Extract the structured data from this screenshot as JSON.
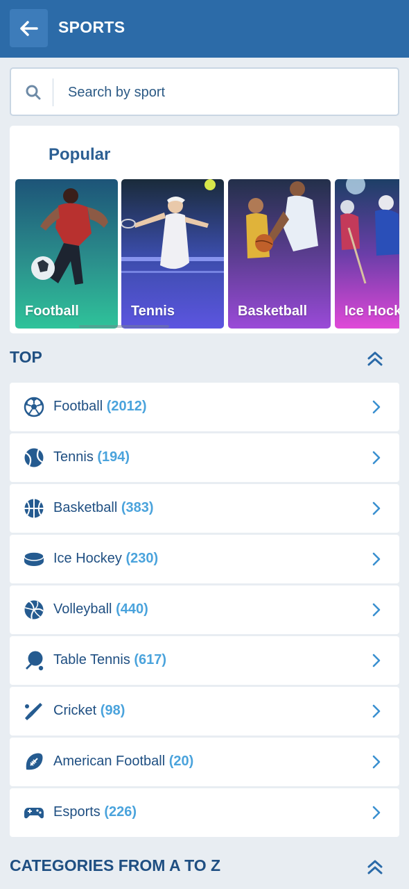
{
  "header": {
    "back_icon": "arrow-left-icon",
    "title": "SPORTS"
  },
  "search": {
    "icon": "search-icon",
    "placeholder": "Search by sport"
  },
  "popular": {
    "title": "Popular",
    "cards": [
      {
        "label": "Football"
      },
      {
        "label": "Tennis"
      },
      {
        "label": "Basketball"
      },
      {
        "label": "Ice Hockey"
      }
    ]
  },
  "top": {
    "title": "TOP",
    "collapse_icon": "double-chevron-up-icon",
    "items": [
      {
        "name": "Football",
        "count": "(2012)",
        "icon": "soccer-ball-icon"
      },
      {
        "name": "Tennis",
        "count": "(194)",
        "icon": "tennis-ball-icon"
      },
      {
        "name": "Basketball",
        "count": "(383)",
        "icon": "basketball-icon"
      },
      {
        "name": "Ice Hockey",
        "count": "(230)",
        "icon": "hockey-puck-icon"
      },
      {
        "name": "Volleyball",
        "count": "(440)",
        "icon": "volleyball-icon"
      },
      {
        "name": "Table Tennis",
        "count": "(617)",
        "icon": "ping-pong-paddle-icon"
      },
      {
        "name": "Cricket",
        "count": "(98)",
        "icon": "cricket-bat-icon"
      },
      {
        "name": "American Football",
        "count": "(20)",
        "icon": "american-football-icon"
      },
      {
        "name": "Esports",
        "count": "(226)",
        "icon": "gamepad-icon"
      }
    ]
  },
  "categories": {
    "title": "CATEGORIES FROM A TO Z",
    "collapse_icon": "double-chevron-up-icon"
  },
  "colors": {
    "header_bg": "#2c6ba8",
    "accent_blue": "#4aa3dc",
    "text_dark_blue": "#1f4f82",
    "page_bg": "#e8edf2"
  }
}
